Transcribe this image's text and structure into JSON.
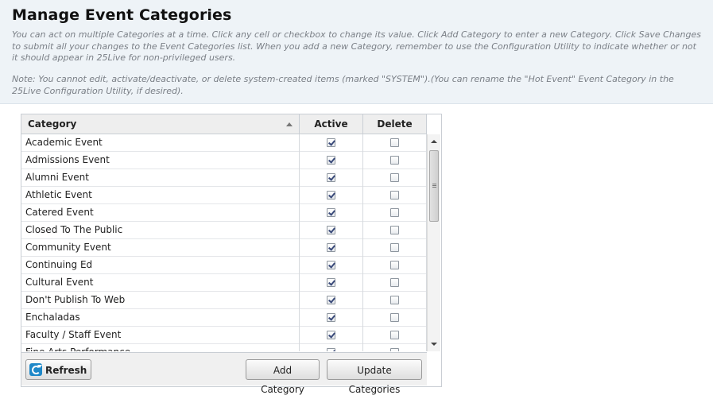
{
  "page": {
    "title": "Manage Event Categories",
    "description": "You can act on multiple Categories at a time. Click any cell or checkbox to change its value. Click Add Category to enter a new Category. Click Save Changes to submit all your changes to the Event Categories list. When you add a new Category, remember to use the Configuration Utility to indicate whether or not it should appear in 25Live for non-privileged users.",
    "note": "Note: You cannot edit, activate/deactivate, or delete system-created items (marked \"SYSTEM\").(You can rename the \"Hot Event\" Event Category in the 25Live Configuration Utility, if desired)."
  },
  "grid": {
    "columns": {
      "category": "Category",
      "active": "Active",
      "delete": "Delete"
    },
    "sort_icon": "sort-ascending-icon",
    "rows": [
      {
        "category": "Academic Event",
        "active": true,
        "delete": false
      },
      {
        "category": "Admissions Event",
        "active": true,
        "delete": false
      },
      {
        "category": "Alumni Event",
        "active": true,
        "delete": false
      },
      {
        "category": "Athletic Event",
        "active": true,
        "delete": false
      },
      {
        "category": "Catered Event",
        "active": true,
        "delete": false
      },
      {
        "category": "Closed To The Public",
        "active": true,
        "delete": false
      },
      {
        "category": "Community Event",
        "active": true,
        "delete": false
      },
      {
        "category": "Continuing Ed",
        "active": true,
        "delete": false
      },
      {
        "category": "Cultural Event",
        "active": true,
        "delete": false
      },
      {
        "category": "Don't Publish To Web",
        "active": true,
        "delete": false
      },
      {
        "category": "Enchaladas",
        "active": true,
        "delete": false
      },
      {
        "category": "Faculty / Staff Event",
        "active": true,
        "delete": false
      },
      {
        "category": "Fine Arts Performance",
        "active": true,
        "delete": false
      }
    ]
  },
  "footer": {
    "refresh_label": "Refresh",
    "refresh_icon": "refresh-icon",
    "add_label": "Add Category",
    "update_label": "Update Categories"
  },
  "colors": {
    "header_bg": "#eef3f7",
    "description_text": "#7a7f86",
    "refresh_icon": "#1e88c8"
  }
}
